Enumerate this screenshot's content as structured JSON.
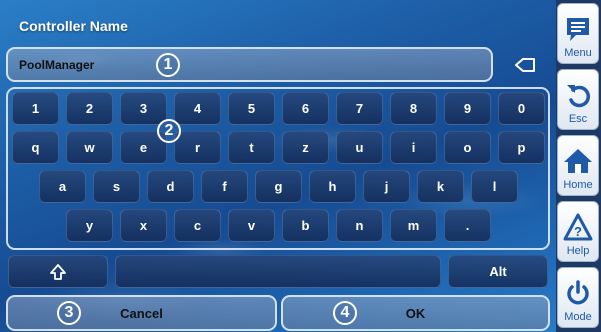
{
  "header": {
    "title": "Controller Name"
  },
  "name_input": {
    "value": "PoolManager",
    "callout": "1"
  },
  "keyboard": {
    "callout": "2",
    "row1": [
      "1",
      "2",
      "3",
      "4",
      "5",
      "6",
      "7",
      "8",
      "9",
      "0"
    ],
    "row2": [
      "q",
      "w",
      "e",
      "r",
      "t",
      "z",
      "u",
      "i",
      "o",
      "p"
    ],
    "row3": [
      "a",
      "s",
      "d",
      "f",
      "g",
      "h",
      "j",
      "k",
      "l"
    ],
    "row4": [
      "y",
      "x",
      "c",
      "v",
      "b",
      "n",
      "m",
      "."
    ],
    "alt": "Alt"
  },
  "actions": {
    "cancel": {
      "label": "Cancel",
      "callout": "3"
    },
    "ok": {
      "label": "OK",
      "callout": "4"
    }
  },
  "sidebar": {
    "menu": "Menu",
    "esc": "Esc",
    "home": "Home",
    "help": "Help",
    "mode": "Mode"
  },
  "colors": {
    "water": "#1d5fa8",
    "sidebar_bg": "#1e3a64",
    "sidebar_icon": "#1e5aa8"
  }
}
